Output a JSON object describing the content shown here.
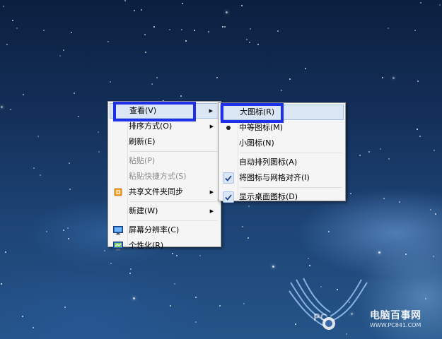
{
  "desktop": {
    "watermark": {
      "brand": "电脑百事网",
      "url": "WWW.PC841.COM"
    }
  },
  "context_menu": {
    "items": [
      {
        "label": "查看(V)",
        "has_submenu": true
      },
      {
        "label": "排序方式(O)",
        "has_submenu": true
      },
      {
        "label": "刷新(E)"
      },
      {
        "label": "粘贴(P)",
        "disabled": true
      },
      {
        "label": "粘贴快捷方式(S)",
        "disabled": true
      },
      {
        "label": "共享文件夹同步",
        "has_submenu": true,
        "icon": "sync-folder-icon"
      },
      {
        "label": "新建(W)",
        "has_submenu": true
      },
      {
        "label": "屏幕分辨率(C)",
        "icon": "monitor-icon"
      },
      {
        "label": "个性化(R)",
        "icon": "personalize-icon"
      }
    ]
  },
  "view_submenu": {
    "items": [
      {
        "label": "大图标(R)"
      },
      {
        "label": "中等图标(M)",
        "selected": true
      },
      {
        "label": "小图标(N)"
      },
      {
        "label": "自动排列图标(A)"
      },
      {
        "label": "将图标与网格对齐(I)",
        "checked": true
      },
      {
        "label": "显示桌面图标(D)",
        "checked": true
      }
    ]
  },
  "annotation_color": "#1f2fe8"
}
